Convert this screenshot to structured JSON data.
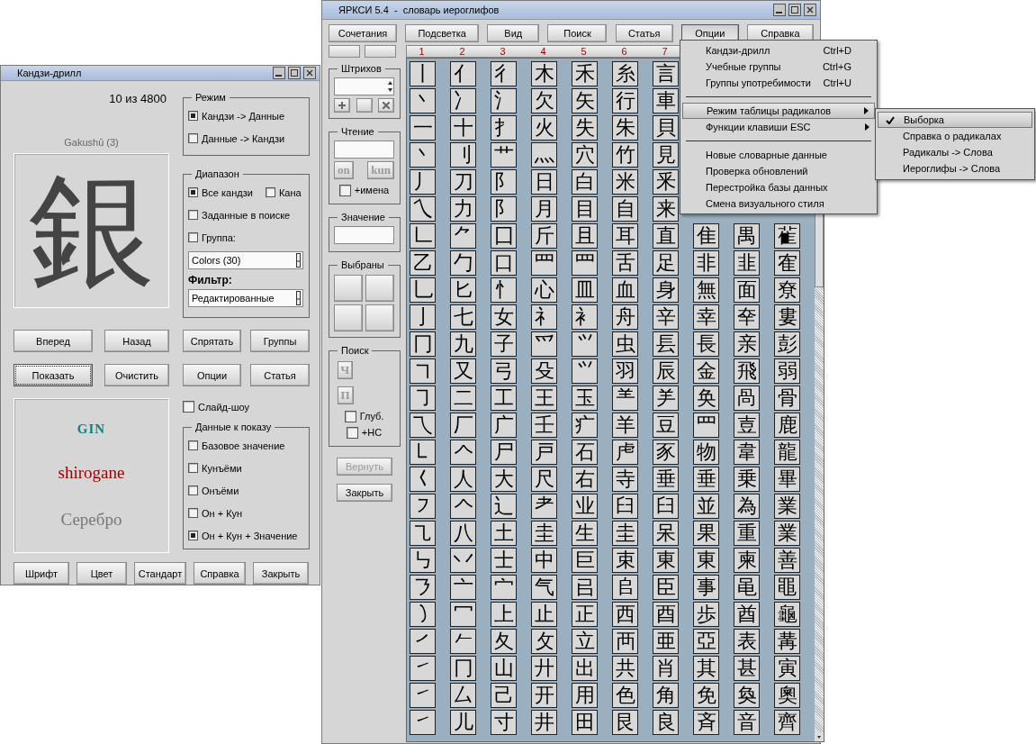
{
  "kanji_drill": {
    "title": "Кандзи-дрилл",
    "counter": "10 из 4800",
    "group_label": "Gakushū (3)",
    "kanji": "銀",
    "readings": [
      {
        "kind": "on",
        "text": "GIN"
      },
      {
        "kind": "kun",
        "text": "shirogane"
      },
      {
        "kind": "meaning",
        "text": "Серебро"
      }
    ],
    "mode": {
      "title": "Режим",
      "options": [
        {
          "label": "Кандзи -> Данные",
          "selected": true
        },
        {
          "label": "Данные -> Кандзи",
          "selected": false
        }
      ]
    },
    "range": {
      "title": "Диапазон",
      "rows": [
        [
          {
            "label": "Все кандзи",
            "selected": true
          },
          {
            "label": "Кана",
            "selected": false
          }
        ],
        [
          {
            "label": "Заданные в поиске",
            "selected": false
          }
        ],
        [
          {
            "label": "Группа:",
            "selected": false
          }
        ]
      ],
      "group_select": "Colors (30)",
      "filter_label": "Фильтр:",
      "filter_select": "Редактированные"
    },
    "buttons": [
      {
        "label": "Вперед",
        "focused": false
      },
      {
        "label": "Назад",
        "focused": false
      },
      {
        "label": "Спрятать",
        "focused": false
      },
      {
        "label": "Группы",
        "focused": false
      },
      {
        "label": "Показать",
        "focused": true
      },
      {
        "label": "Очистить",
        "focused": false
      },
      {
        "label": "Опции",
        "focused": false
      },
      {
        "label": "Статья",
        "focused": false
      }
    ],
    "slideshow": {
      "label": "Слайд-шоу",
      "checked": false
    },
    "display": {
      "title": "Данные к показу",
      "options": [
        {
          "label": "Базовое значение",
          "selected": false
        },
        {
          "label": "Кунъёми",
          "selected": false
        },
        {
          "label": "Онъёми",
          "selected": false
        },
        {
          "label": "Он + Кун",
          "selected": false
        },
        {
          "label": "Он + Кун + Значение",
          "selected": true
        }
      ]
    },
    "bottom_buttons": [
      "Шрифт",
      "Цвет",
      "Стандарт",
      "Справка",
      "Закрыть"
    ]
  },
  "dictionary": {
    "title": "ЯРКСИ 5.4  -  словарь иероглифов",
    "toolbar": [
      {
        "label": "Сочетания",
        "selected": false
      },
      {
        "label": "Подсветка",
        "selected": false
      },
      {
        "label": "Вид",
        "selected": false
      },
      {
        "label": "Поиск",
        "selected": false
      },
      {
        "label": "Статья",
        "selected": false
      },
      {
        "label": "Опции",
        "selected": true
      },
      {
        "label": "Справка",
        "selected": false
      }
    ],
    "strokes": {
      "title": "Штрихов"
    },
    "reading": {
      "title": "Чтение",
      "buttons": [
        {
          "label": "on",
          "disabled": true
        },
        {
          "label": "kun",
          "disabled": true
        }
      ],
      "names": {
        "label": "+имена",
        "checked": false
      }
    },
    "meaning": {
      "title": "Значение"
    },
    "chosen": {
      "title": "Выбраны"
    },
    "search": {
      "title": "Поиск",
      "buttons": [
        {
          "label": "Ч",
          "disabled": true
        },
        {
          "label": "П",
          "disabled": true
        }
      ],
      "options": [
        {
          "label": "Глуб.",
          "checked": false
        },
        {
          "label": "+НС",
          "checked": false
        }
      ]
    },
    "actions": [
      {
        "label": "Вернуть",
        "disabled": true
      },
      {
        "label": "Закрыть",
        "disabled": false
      }
    ],
    "column_headers": [
      "1",
      "2",
      "3",
      "4",
      "5",
      "6",
      "7"
    ],
    "rows": [
      [
        "丨",
        "亻",
        "彳",
        "木",
        "禾",
        "糸",
        "言"
      ],
      [
        "丶",
        "冫",
        "氵",
        "欠",
        "矢",
        "行",
        "車"
      ],
      [
        "一",
        "十",
        "扌",
        "火",
        "失",
        "朱",
        "貝"
      ],
      [
        "丶",
        "刂",
        "艹",
        "灬",
        "穴",
        "竹",
        "見"
      ],
      [
        "丿",
        "刀",
        "阝",
        "日",
        "白",
        "米",
        "釆"
      ],
      [
        "乀",
        "力",
        "阝",
        "月",
        "目",
        "自",
        "来"
      ],
      [
        "𠃊",
        "⺈",
        "囗",
        "斤",
        "且",
        "耳",
        "直",
        "隹",
        "禺",
        "雈"
      ],
      [
        "乙",
        "勹",
        "口",
        "罒",
        "罒",
        "舌",
        "足",
        "非",
        "韭",
        "隺"
      ],
      [
        "乚",
        "匕",
        "忄",
        "心",
        "皿",
        "血",
        "身",
        "無",
        "面",
        "尞"
      ],
      [
        "亅",
        "七",
        "女",
        "礻",
        "衤",
        "舟",
        "辛",
        "幸",
        "㚔",
        "婁"
      ],
      [
        "冂",
        "九",
        "子",
        "爫",
        "⺍",
        "虫",
        "镸",
        "長",
        "亲",
        "彭"
      ],
      [
        "㇕",
        "又",
        "弓",
        "殳",
        "⺍",
        "羽",
        "辰",
        "金",
        "飛",
        "弱"
      ],
      [
        "㇆",
        "二",
        "工",
        "王",
        "玉",
        "⺷",
        "⺶",
        "奂",
        "咼",
        "骨"
      ],
      [
        "乁",
        "厂",
        "广",
        "壬",
        "疒",
        "羊",
        "豆",
        "罒",
        "壴",
        "鹿"
      ],
      [
        "㇄",
        "𠆢",
        "尸",
        "戸",
        "石",
        "虍",
        "豕",
        "物",
        "韋",
        "龍"
      ],
      [
        "𡿨",
        "人",
        "大",
        "尺",
        "右",
        "寺",
        "垂",
        "垂",
        "乗",
        "畢"
      ],
      [
        "㇇",
        "𠆢",
        "辶",
        "耂",
        "业",
        "臼",
        "臼",
        "並",
        "為",
        "業"
      ],
      [
        "㇈",
        "八",
        "土",
        "圭",
        "生",
        "圭",
        "呆",
        "果",
        "重",
        "業"
      ],
      [
        "㇉",
        "丷",
        "士",
        "中",
        "巨",
        "束",
        "東",
        "東",
        "柬",
        "善"
      ],
      [
        "㇋",
        "亠",
        "宀",
        "气",
        "㠯",
        "𠂤",
        "臣",
        "事",
        "黾",
        "黽"
      ],
      [
        "㇁",
        "冖",
        "上",
        "止",
        "正",
        "西",
        "酉",
        "歩",
        "酋",
        "龜"
      ],
      [
        "㇒",
        "𠂉",
        "夂",
        "攵",
        "立",
        "襾",
        "亜",
        "亞",
        "表",
        "冓"
      ],
      [
        "㇀",
        "冂",
        "山",
        "廾",
        "出",
        "共",
        "肖",
        "其",
        "甚",
        "寅"
      ],
      [
        "㇀",
        "厶",
        "己",
        "开",
        "用",
        "色",
        "角",
        "免",
        "奐",
        "奧"
      ],
      [
        "㇀",
        "儿",
        "寸",
        "井",
        "田",
        "艮",
        "良",
        "斉",
        "音",
        "齊"
      ]
    ]
  },
  "options_menu": {
    "items": [
      {
        "kind": "item",
        "label": "Кандзи-дрилл",
        "shortcut": "Ctrl+D",
        "selected": false
      },
      {
        "kind": "item",
        "label": "Учебные группы",
        "shortcut": "Ctrl+G",
        "selected": false
      },
      {
        "kind": "item",
        "label": "Группы употребимости",
        "shortcut": "Ctrl+U",
        "selected": false
      },
      {
        "kind": "separator"
      },
      {
        "kind": "submenu",
        "label": "Режим таблицы радикалов",
        "selected": true
      },
      {
        "kind": "submenu",
        "label": "Функции клавиши ESC",
        "selected": false
      },
      {
        "kind": "separator"
      },
      {
        "kind": "item",
        "label": "Новые словарные данные",
        "selected": false
      },
      {
        "kind": "item",
        "label": "Проверка обновлений",
        "selected": false
      },
      {
        "kind": "item",
        "label": "Перестройка базы данных",
        "selected": false
      },
      {
        "kind": "item",
        "label": "Смена визуального стиля",
        "selected": false
      }
    ]
  },
  "submenu": {
    "items": [
      {
        "label": "Выборка",
        "checked": true,
        "selected": true
      },
      {
        "label": "Справка о радикалах",
        "checked": false,
        "selected": false
      },
      {
        "label": "Радикалы -> Слова",
        "checked": false,
        "selected": false
      },
      {
        "label": "Иероглифы -> Слова",
        "checked": false,
        "selected": false
      }
    ]
  }
}
